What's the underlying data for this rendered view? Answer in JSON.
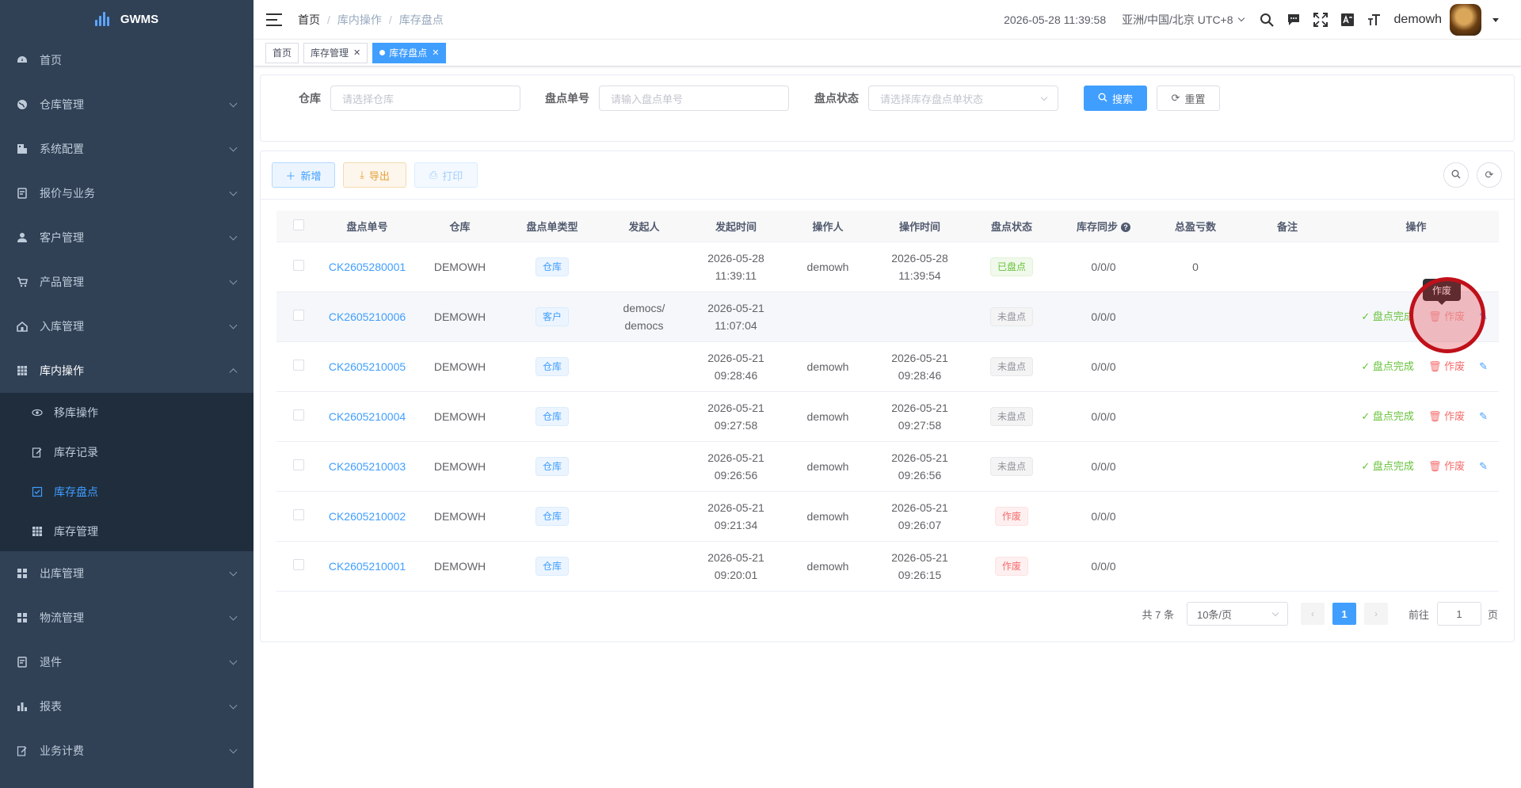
{
  "app": {
    "name": "GWMS"
  },
  "sidebar": {
    "items": [
      {
        "label": "首页",
        "icon": "dashboard-icon"
      },
      {
        "label": "仓库管理",
        "icon": "globe-icon"
      },
      {
        "label": "系统配置",
        "icon": "building-icon"
      },
      {
        "label": "报价与业务",
        "icon": "form-icon"
      },
      {
        "label": "客户管理",
        "icon": "user-icon"
      },
      {
        "label": "产品管理",
        "icon": "cart-icon"
      },
      {
        "label": "入库管理",
        "icon": "home-icon"
      },
      {
        "label": "库内操作",
        "icon": "grid-icon"
      }
    ],
    "subitems": [
      {
        "label": "移库操作",
        "icon": "eye-icon"
      },
      {
        "label": "库存记录",
        "icon": "edit-icon"
      },
      {
        "label": "库存盘点",
        "icon": "checkbox-icon"
      },
      {
        "label": "库存管理",
        "icon": "table-icon"
      }
    ],
    "items_after": [
      {
        "label": "出库管理",
        "icon": "apps-icon"
      },
      {
        "label": "物流管理",
        "icon": "apps-icon"
      },
      {
        "label": "退件",
        "icon": "form-icon"
      },
      {
        "label": "报表",
        "icon": "bar-chart-icon"
      },
      {
        "label": "业务计费",
        "icon": "edit-icon"
      }
    ]
  },
  "header": {
    "breadcrumb": [
      "首页",
      "库内操作",
      "库存盘点"
    ],
    "datetime": "2026-05-28 11:39:58",
    "timezone": "亚洲/中国/北京 UTC+8",
    "username": "demowh"
  },
  "tags": [
    {
      "label": "首页"
    },
    {
      "label": "库存管理"
    },
    {
      "label": "库存盘点"
    }
  ],
  "search": {
    "warehouse_label": "仓库",
    "warehouse_placeholder": "请选择仓库",
    "order_label": "盘点单号",
    "order_placeholder": "请输入盘点单号",
    "status_label": "盘点状态",
    "status_placeholder": "请选择库存盘点单状态",
    "search_btn": "搜索",
    "reset_btn": "重置"
  },
  "toolbar": {
    "add": "新增",
    "export": "导出",
    "print": "打印"
  },
  "table": {
    "headers": [
      "盘点单号",
      "仓库",
      "盘点单类型",
      "发起人",
      "发起时间",
      "操作人",
      "操作时间",
      "盘点状态",
      "库存同步",
      "总盈亏数",
      "备注",
      "操作"
    ],
    "rows": [
      {
        "no": "CK2605280001",
        "wh": "DEMOWH",
        "type": "仓库",
        "initiator": "",
        "init_date": "2026-05-28",
        "init_time": "11:39:11",
        "operator": "demowh",
        "op_date": "2026-05-28",
        "op_time": "11:39:54",
        "status": "已盘点",
        "sync": "0/0/0",
        "total": "0",
        "remark": ""
      },
      {
        "no": "CK2605210006",
        "wh": "DEMOWH",
        "type": "客户",
        "initiator": "democs/",
        "initiator2": "democs",
        "init_date": "2026-05-21",
        "init_time": "11:07:04",
        "operator": "",
        "op_date": "",
        "op_time": "",
        "status": "未盘点",
        "sync": "0/0/0",
        "total": "",
        "remark": ""
      },
      {
        "no": "CK2605210005",
        "wh": "DEMOWH",
        "type": "仓库",
        "initiator": "",
        "init_date": "2026-05-21",
        "init_time": "09:28:46",
        "operator": "demowh",
        "op_date": "2026-05-21",
        "op_time": "09:28:46",
        "status": "未盘点",
        "sync": "0/0/0",
        "total": "",
        "remark": ""
      },
      {
        "no": "CK2605210004",
        "wh": "DEMOWH",
        "type": "仓库",
        "initiator": "",
        "init_date": "2026-05-21",
        "init_time": "09:27:58",
        "operator": "demowh",
        "op_date": "2026-05-21",
        "op_time": "09:27:58",
        "status": "未盘点",
        "sync": "0/0/0",
        "total": "",
        "remark": ""
      },
      {
        "no": "CK2605210003",
        "wh": "DEMOWH",
        "type": "仓库",
        "initiator": "",
        "init_date": "2026-05-21",
        "init_time": "09:26:56",
        "operator": "demowh",
        "op_date": "2026-05-21",
        "op_time": "09:26:56",
        "status": "未盘点",
        "sync": "0/0/0",
        "total": "",
        "remark": ""
      },
      {
        "no": "CK2605210002",
        "wh": "DEMOWH",
        "type": "仓库",
        "initiator": "",
        "init_date": "2026-05-21",
        "init_time": "09:21:34",
        "operator": "demowh",
        "op_date": "2026-05-21",
        "op_time": "09:26:07",
        "status": "作废",
        "sync": "0/0/0",
        "total": "",
        "remark": ""
      },
      {
        "no": "CK2605210001",
        "wh": "DEMOWH",
        "type": "仓库",
        "initiator": "",
        "init_date": "2026-05-21",
        "init_time": "09:20:01",
        "operator": "demowh",
        "op_date": "2026-05-21",
        "op_time": "09:26:15",
        "status": "作废",
        "sync": "0/0/0",
        "total": "",
        "remark": ""
      }
    ],
    "op_done": "盘点完成",
    "op_void": "作废"
  },
  "tooltip": "作废",
  "pagination": {
    "total": "共 7 条",
    "page_size": "10条/页",
    "current": "1",
    "goto_label": "前往",
    "goto_value": "1",
    "page_unit": "页"
  },
  "colors": {
    "sidebar_bg": "#304156",
    "submenu_bg": "#1f2d3d",
    "primary": "#409eff",
    "success": "#67c23a",
    "danger": "#f56c6c",
    "warning": "#e6a23c"
  }
}
